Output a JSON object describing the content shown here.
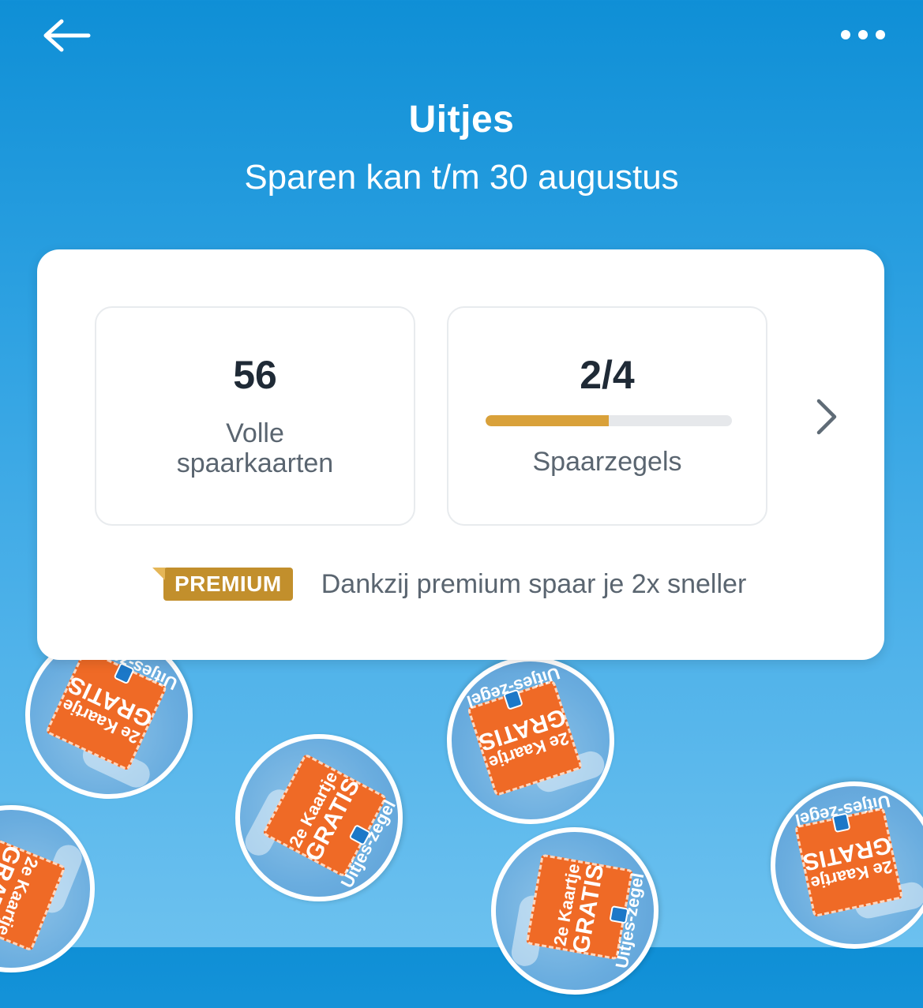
{
  "header": {
    "back_icon": "arrow-left-icon",
    "more_icon": "more-horizontal-icon",
    "title": "Uitjes",
    "subtitle": "Sparen kan t/m 30 augustus"
  },
  "card": {
    "full_cards": {
      "value": "56",
      "label_line1": "Volle",
      "label_line2": "spaarkaarten"
    },
    "stamps": {
      "value": "2/4",
      "current": 2,
      "total": 4,
      "progress_fraction": 0.5,
      "label": "Spaarzegels"
    },
    "chevron_icon": "chevron-right-icon",
    "premium": {
      "badge": "PREMIUM",
      "text": "Dankzij premium spaar je 2x sneller"
    }
  },
  "stamp_graphic": {
    "ticket_line1": "2e Kaartje",
    "ticket_line2": "GRATIS",
    "ring_text": "Uitjes-zegel"
  },
  "colors": {
    "background_top": "#0f8fd6",
    "background_bottom": "#6cc1ef",
    "progress": "#d9a13a",
    "premium_badge": "#c28f2c",
    "ticket": "#ef6a26"
  }
}
